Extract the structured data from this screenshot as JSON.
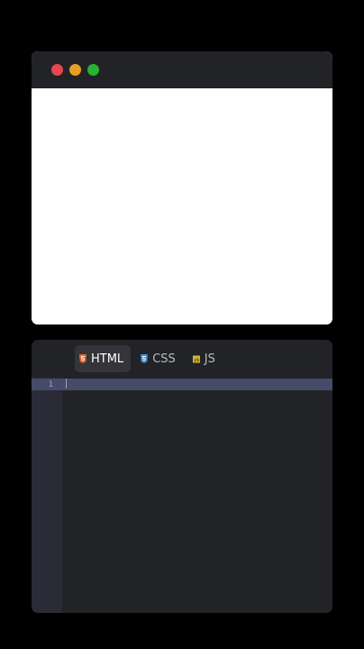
{
  "browser": {
    "dots": [
      {
        "name": "close",
        "color": "#e5484d"
      },
      {
        "name": "minimize",
        "color": "#e5a024"
      },
      {
        "name": "maximize",
        "color": "#28b235"
      }
    ]
  },
  "editor": {
    "tabs": [
      {
        "label": "HTML",
        "icon": "html5-icon",
        "icon_color": "#e8652d",
        "active": true
      },
      {
        "label": "CSS",
        "icon": "css3-icon",
        "icon_color": "#3f8fd2",
        "active": false
      },
      {
        "label": "JS",
        "icon": "javascript-icon",
        "icon_color": "#d6b62a",
        "active": false
      }
    ],
    "lines": [
      {
        "number": "1",
        "text": ""
      }
    ]
  }
}
